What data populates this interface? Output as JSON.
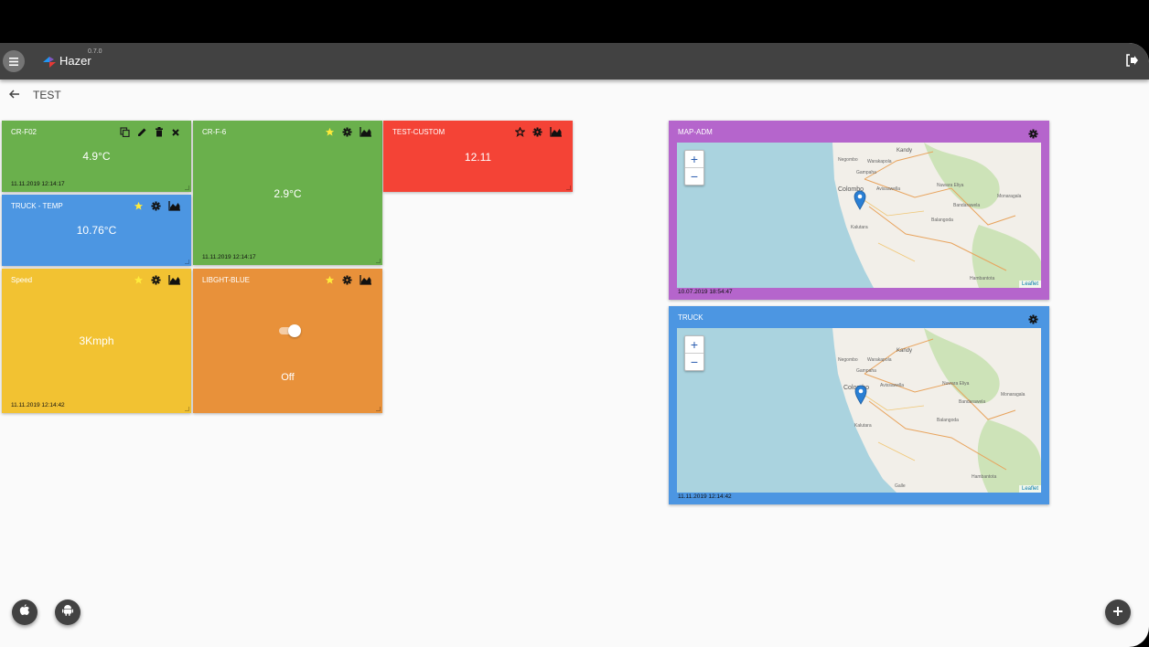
{
  "app": {
    "title": "Hazer",
    "version": "0.7.0"
  },
  "breadcrumb": {
    "title": "TEST"
  },
  "tiles": [
    {
      "name": "CR-F02",
      "value": "4.9°C",
      "date": "11.11.2019 12:14:17",
      "color": "#6ab04c"
    },
    {
      "name": "CR-F-6",
      "value": "2.9°C",
      "date": "11.11.2019 12:14:17",
      "color": "#6ab04c"
    },
    {
      "name": "TEST-CUSTOM",
      "value": "12.11",
      "color": "#f44336"
    },
    {
      "name": "TRUCK - TEMP",
      "value": "10.76°C",
      "color": "#4c96e2"
    },
    {
      "name": "Speed",
      "value": "3Kmph",
      "date": "11.11.2019 12:14:42",
      "color": "#f2c232"
    },
    {
      "name": "LIBGHT-BLUE",
      "value": "Off",
      "toggle_on": false,
      "color": "#e8913a"
    }
  ],
  "maps": [
    {
      "name": "MAP-ADM",
      "date": "10.07.2019 18:54:47",
      "color": "#b565cc",
      "attribution": "Leaflet"
    },
    {
      "name": "TRUCK",
      "date": "11.11.2019 12:14:42",
      "color": "#4c96e2",
      "attribution": "Leaflet"
    }
  ],
  "map_places": [
    "Kandy",
    "Colombo",
    "Negombo",
    "Gampaha",
    "Avissawella",
    "Nuwara Eliya",
    "Bandarawela",
    "Monaragala",
    "Balangoda",
    "Kalutara",
    "Hambantota",
    "Galle",
    "Warakapola"
  ],
  "zoom": {
    "in": "+",
    "out": "−"
  },
  "icons": {
    "menu": "menu-icon",
    "logo": "hazer-logo-icon",
    "logout": "logout-icon",
    "back": "back-arrow-icon",
    "copy": "copy-icon",
    "edit": "pencil-icon",
    "delete": "trash-icon",
    "close": "close-icon",
    "star": "star-icon",
    "settings": "gear-icon",
    "chart": "chart-icon",
    "apple": "apple-icon",
    "android": "android-icon",
    "add": "plus-icon"
  },
  "colors": {
    "appbar": "#424242",
    "background": "#fafafa",
    "star_active": "#ffeb3b"
  }
}
